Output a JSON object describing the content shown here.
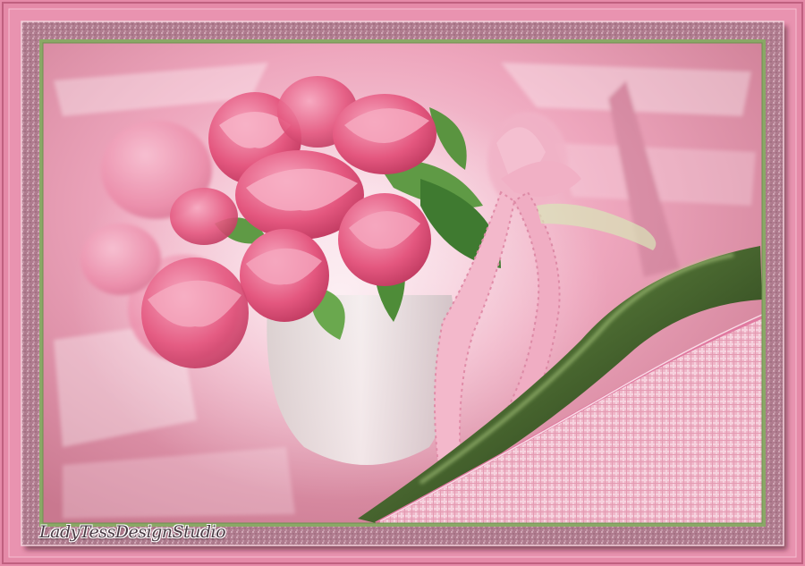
{
  "artwork": {
    "subject": "pink-tulip-bouquet",
    "signature_text": "LadyTessDesignStudio"
  },
  "colors": {
    "outer_pink": "#e58aa8",
    "frame_mauve": "#b37f92",
    "frame_green": "#8aa866",
    "tulip_pink": "#e0507a",
    "leaf_green": "#4f8a3a",
    "curl_green": "#3d5a2a",
    "plaid_pink": "#eeb5c8"
  }
}
